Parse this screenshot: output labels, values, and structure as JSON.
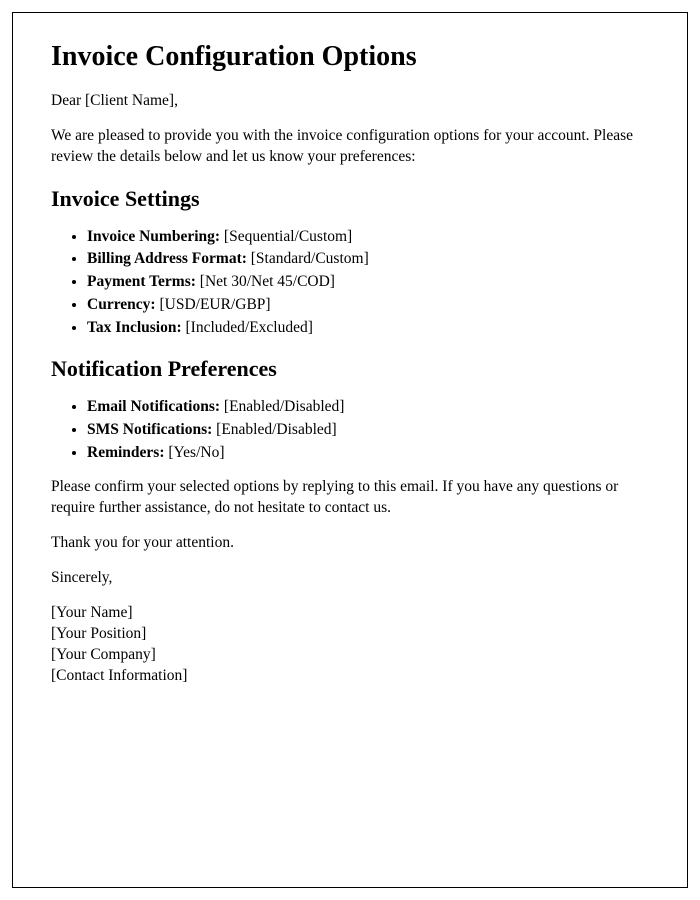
{
  "title": "Invoice Configuration Options",
  "greeting": "Dear [Client Name],",
  "intro": "We are pleased to provide you with the invoice configuration options for your account. Please review the details below and let us know your preferences:",
  "section1": {
    "heading": "Invoice Settings",
    "items": [
      {
        "label": "Invoice Numbering:",
        "value": " [Sequential/Custom]"
      },
      {
        "label": "Billing Address Format:",
        "value": " [Standard/Custom]"
      },
      {
        "label": "Payment Terms:",
        "value": " [Net 30/Net 45/COD]"
      },
      {
        "label": "Currency:",
        "value": " [USD/EUR/GBP]"
      },
      {
        "label": "Tax Inclusion:",
        "value": " [Included/Excluded]"
      }
    ]
  },
  "section2": {
    "heading": "Notification Preferences",
    "items": [
      {
        "label": "Email Notifications:",
        "value": " [Enabled/Disabled]"
      },
      {
        "label": "SMS Notifications:",
        "value": " [Enabled/Disabled]"
      },
      {
        "label": "Reminders:",
        "value": " [Yes/No]"
      }
    ]
  },
  "closing1": "Please confirm your selected options by replying to this email. If you have any questions or require further assistance, do not hesitate to contact us.",
  "closing2": "Thank you for your attention.",
  "signoff": "Sincerely,",
  "signature": {
    "name": "[Your Name]",
    "position": "[Your Position]",
    "company": "[Your Company]",
    "contact": "[Contact Information]"
  }
}
